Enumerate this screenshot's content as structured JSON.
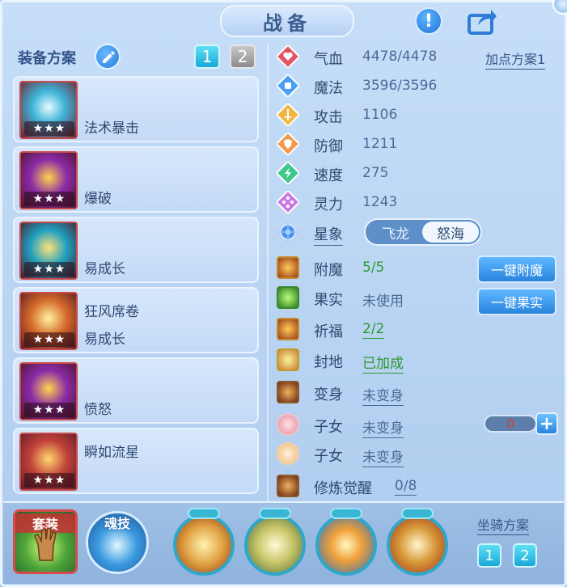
{
  "window": {
    "title": "战备"
  },
  "equipment": {
    "title": "装备方案",
    "plans": [
      "1",
      "2"
    ],
    "items": [
      {
        "stars": "★★★",
        "lines": [
          "法术暴击"
        ]
      },
      {
        "stars": "★★★",
        "lines": [
          "爆破"
        ]
      },
      {
        "stars": "★★★",
        "lines": [
          "易成长"
        ]
      },
      {
        "stars": "★★★",
        "lines": [
          "狂风席卷",
          "易成长"
        ]
      },
      {
        "stars": "★★★",
        "lines": [
          "愤怒"
        ]
      },
      {
        "stars": "★★★",
        "lines": [
          "瞬如流星"
        ]
      }
    ]
  },
  "stats": {
    "addpoint_plan": "加点方案1",
    "hp": {
      "name": "气血",
      "value": "4478/4478"
    },
    "mp": {
      "name": "魔法",
      "value": "3596/3596"
    },
    "atk": {
      "name": "攻击",
      "value": "1106"
    },
    "def": {
      "name": "防御",
      "value": "1211"
    },
    "spd": {
      "name": "速度",
      "value": "275"
    },
    "spi": {
      "name": "灵力",
      "value": "1243"
    },
    "star": {
      "name": "星象",
      "options": [
        "飞龙",
        "怒海"
      ],
      "selected": "怒海"
    }
  },
  "extras": {
    "enchant": {
      "name": "附魔",
      "value": "5/5"
    },
    "fruit": {
      "name": "果实",
      "value": "未使用"
    },
    "bless": {
      "name": "祈福",
      "value": "2/2"
    },
    "fief": {
      "name": "封地",
      "value": "已加成"
    },
    "transform": {
      "name": "变身",
      "value": "未变身"
    },
    "child1": {
      "name": "子女",
      "value": "未变身"
    },
    "child2": {
      "name": "子女",
      "value": "未变身"
    },
    "cultivation": {
      "name": "修炼觉醒",
      "value": "0/8"
    },
    "enchant_button": "一键附魔",
    "fruit_button": "一键果实",
    "counter_value": "0",
    "plus_label": "+"
  },
  "bottom": {
    "suit_label": "套装",
    "soul_label": "魂技",
    "mount_title": "坐骑方案",
    "mount_plans": [
      "1",
      "2"
    ]
  },
  "icons": {
    "info": "exclamation-icon",
    "share": "share-icon",
    "edit": "pencil-icon"
  }
}
